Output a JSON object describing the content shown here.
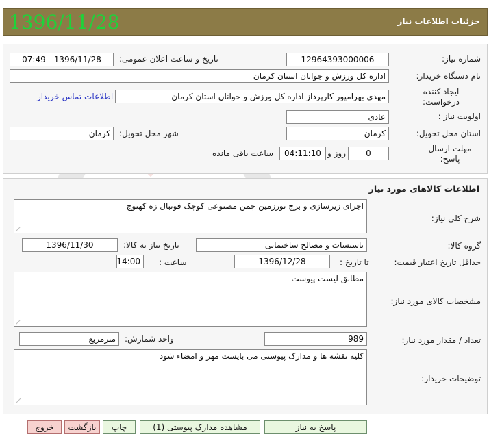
{
  "header": {
    "title": "جزئیات اطلاعات نیاز",
    "date": "1396/11/28"
  },
  "info": {
    "need_number_label": "شماره نیاز:",
    "need_number": "12964393000006",
    "announce_label": "تاریخ و ساعت اعلان عمومی:",
    "announce_value": "1396/11/28 - 07:49",
    "buyer_label": "نام دستگاه خریدار:",
    "buyer_value": "اداره کل ورزش و جوانان استان کرمان",
    "creator_label": "ایجاد کننده درخواست:",
    "creator_value": "مهدی  بهرامپور  کارپرداز  اداره کل ورزش و جوانان استان کرمان",
    "contact_link": "اطلاعات تماس خریدار",
    "priority_label": "اولویت نیاز :",
    "priority_value": "عادی",
    "province_label": "استان محل تحویل:",
    "province_value": "کرمان",
    "city_label": "شهر محل تحویل:",
    "city_value": "کرمان",
    "deadline_label": "مهلت ارسال پاسخ:",
    "days_value": "0",
    "day_text": "روز و",
    "time_value": "04:11:10",
    "remaining_text": "ساعت باقی مانده"
  },
  "goods": {
    "section_title": "اطلاعات کالاهای مورد نیاز",
    "desc_label": "شرح کلی نیاز:",
    "desc_value": "اجرای  زیرسازی و برج نورزمین  چمن مصنوعی کوچک فوتبال زه کهنوج",
    "group_label": "گروه کالا:",
    "group_value": "تاسیسات و مصالح ساختمانی",
    "need_date_label": "تاریخ نیاز به کالا:",
    "need_date_value": "1396/11/30",
    "validity_label": "حداقل تاریخ اعتبار قیمت:",
    "until_label": "تا تاریخ :",
    "validity_date": "1396/12/28",
    "hour_label": "ساعت :",
    "validity_time": "14:00",
    "specs_label": "مشخصات کالای مورد نیاز:",
    "specs_value": "مطابق لیست پیوست",
    "qty_label": "تعداد / مقدار مورد نیاز:",
    "qty_value": "989",
    "unit_label": "واحد شمارش:",
    "unit_value": "مترمربع",
    "buyer_notes_label": "توضیحات خریدار:",
    "buyer_notes_value": "کلیه نقشه ها و مدارک پیوستی می بایست مهر و  امضاء شود"
  },
  "buttons": {
    "reply": "پاسخ به نیاز",
    "attachments": "مشاهده مدارک پیوستی (1)",
    "print": "چاپ",
    "back": "بازگشت",
    "exit": "خروج"
  },
  "colors": {
    "header_bg": "#8c7b47",
    "date_green": "#1ed33a",
    "btn_green": "#e9f7df",
    "btn_red": "#f7d2cf"
  }
}
